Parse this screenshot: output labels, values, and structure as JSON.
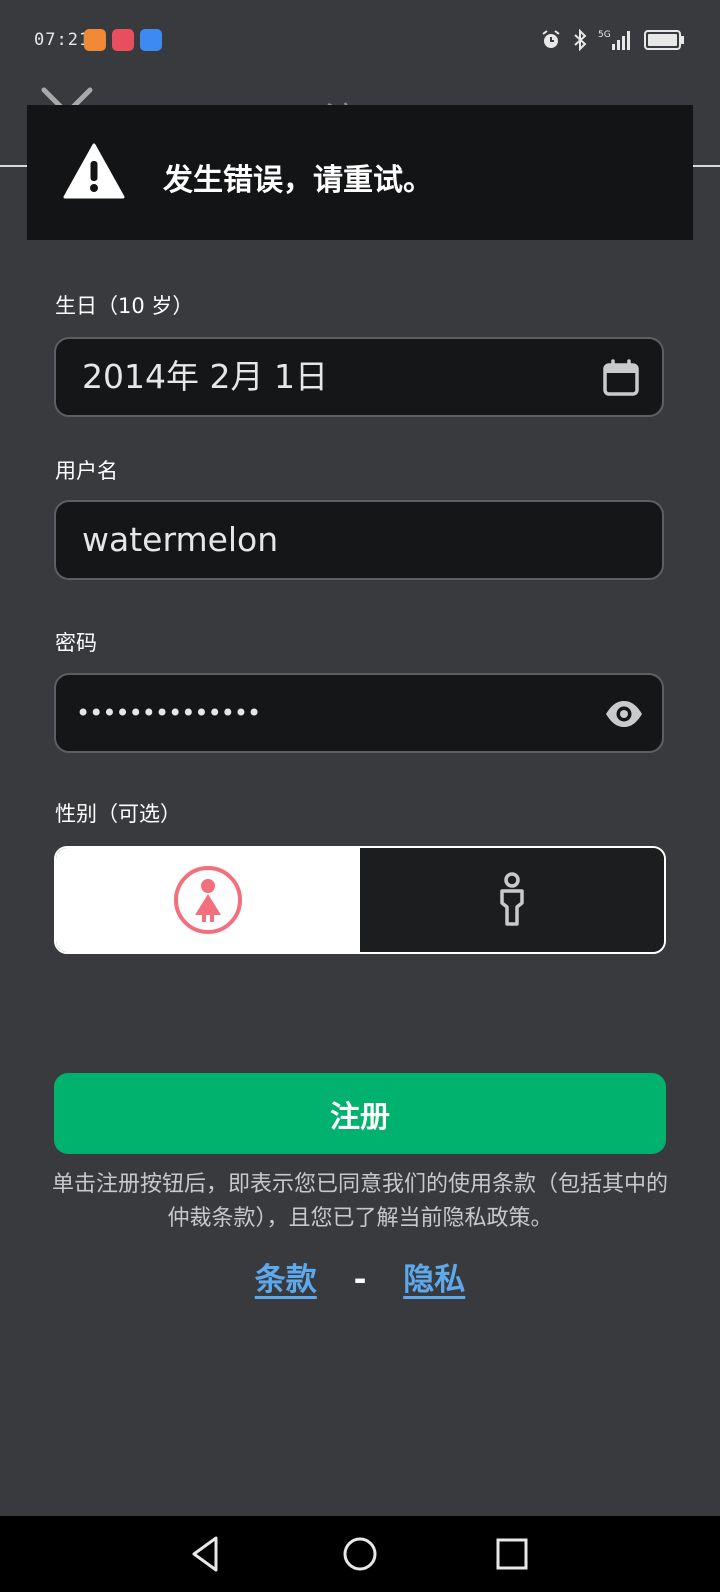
{
  "status_bar": {
    "time": "07:21"
  },
  "header": {
    "title": "注册"
  },
  "error_banner": {
    "message": "发生错误，请重试。"
  },
  "form": {
    "birthday": {
      "label": "生日（10 岁）",
      "value": "2014年 2月 1日"
    },
    "username": {
      "label": "用户名",
      "value": "watermelon"
    },
    "password": {
      "label": "密码",
      "value": "••••••••••••••"
    },
    "gender": {
      "label": "性别（可选）",
      "selected": "female"
    }
  },
  "register_button": {
    "label": "注册"
  },
  "terms_note": "单击注册按钮后，即表示您已同意我们的使用条款（包括其中的仲裁条款），且您已了解当前隐私政策。",
  "links": {
    "terms": "条款",
    "separator": "-",
    "privacy": "隐私"
  },
  "colors": {
    "background": "#393A3D",
    "accent_green": "#00B26E",
    "link_blue": "#5EA8EC",
    "female_pink": "#F26F7E"
  }
}
